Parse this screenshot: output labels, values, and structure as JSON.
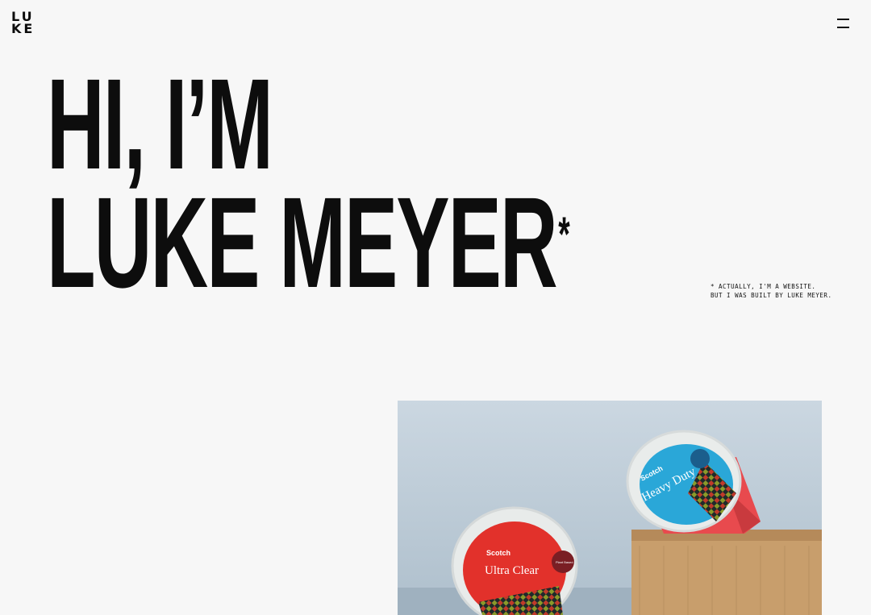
{
  "header": {
    "logo_line1": "LU",
    "logo_line2": "KE",
    "menu_icon": "hamburger-menu-icon"
  },
  "hero": {
    "line1": "HI, I’M",
    "line2": "LUKE MEYER",
    "asterisk": "*"
  },
  "footnote": {
    "line1": "* ACTUALLY, I'M A WEBSITE.",
    "line2": "BUT I WAS BUILT BY LUKE MEYER."
  },
  "feature_image": {
    "tape_left": {
      "brand": "Scotch",
      "product": "Ultra Clear",
      "badge": "Plant Based"
    },
    "tape_right": {
      "brand": "Scotch",
      "product": "Heavy Duty"
    }
  },
  "colors": {
    "background": "#f7f7f7",
    "text": "#0c0c0c",
    "tape_red": "#e2312b",
    "tape_blue": "#2aa7d8",
    "dispenser_red": "#e84a4e",
    "box": "#c9a06f"
  }
}
